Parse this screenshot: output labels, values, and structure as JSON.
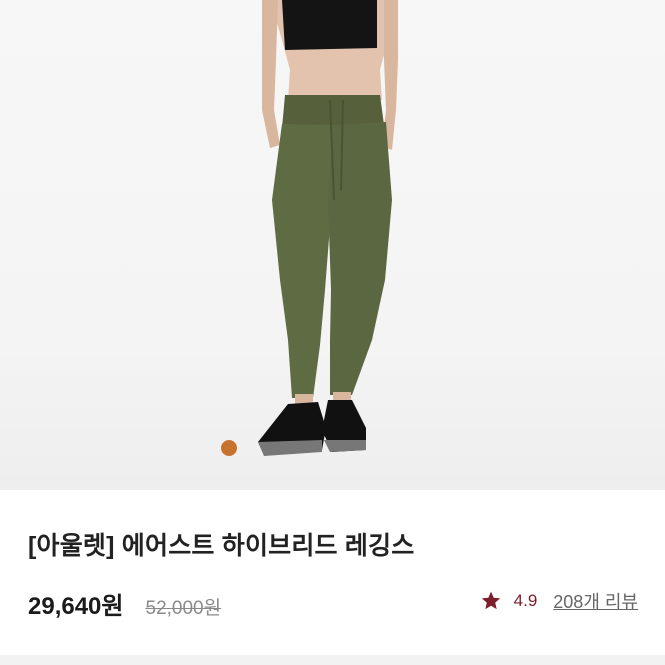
{
  "product": {
    "image_alt": "product photo",
    "title": "[아울렛] 에어스트 하이브리드 레깅스",
    "sale_price": "29,640원",
    "original_price": "52,000원",
    "rating": "4.9",
    "review_count_label": "208개 리뷰"
  },
  "carousel": {
    "active_color": "#c8722f"
  },
  "colors": {
    "star": "#7a1f2b",
    "pants": "#5f6b43"
  },
  "icons": {
    "rating": "star-icon"
  }
}
